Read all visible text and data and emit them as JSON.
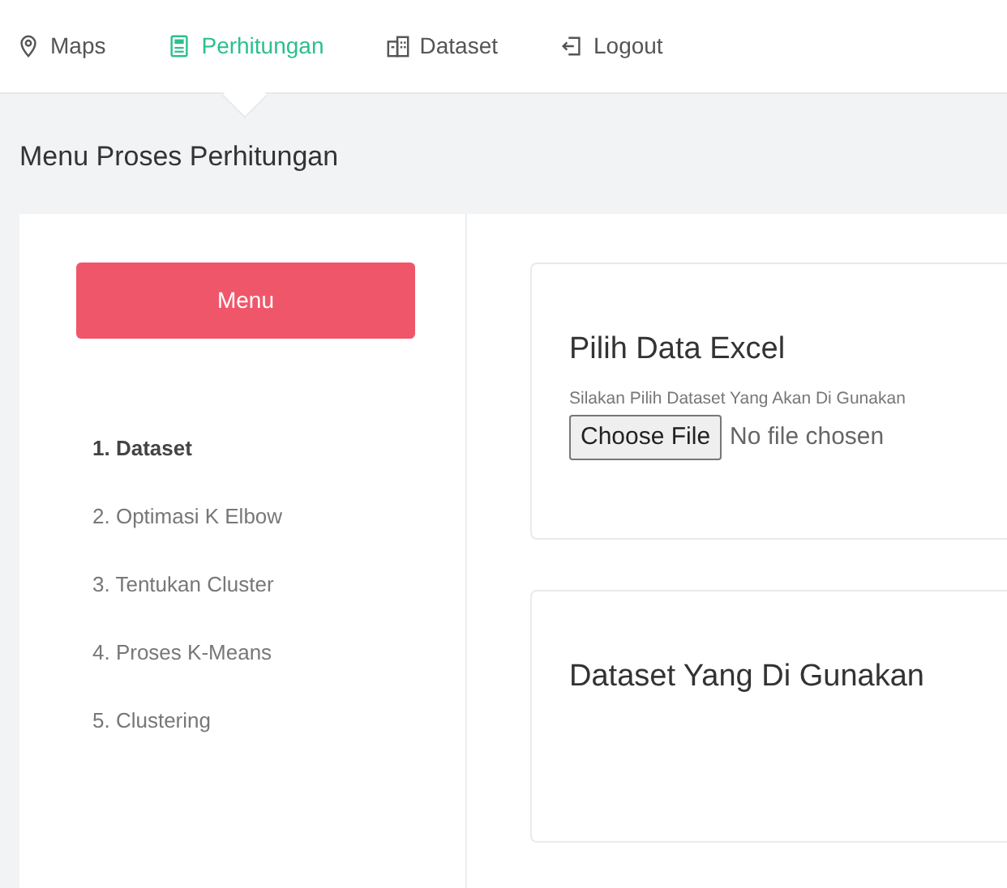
{
  "nav": [
    {
      "label": "Maps",
      "selected": false
    },
    {
      "label": "Perhitungan",
      "selected": true
    },
    {
      "label": "Dataset",
      "selected": false
    },
    {
      "label": "Logout",
      "selected": false
    }
  ],
  "page_title": "Menu Proses Perhitungan",
  "sidebar": {
    "button": "Menu",
    "items": [
      {
        "label": "1. Dataset",
        "selected": true
      },
      {
        "label": "2. Optimasi K Elbow",
        "selected": false
      },
      {
        "label": "3. Tentukan Cluster",
        "selected": false
      },
      {
        "label": "4. Proses K-Means",
        "selected": false
      },
      {
        "label": "5. Clustering",
        "selected": false
      }
    ]
  },
  "upload_card": {
    "title": "Pilih Data Excel",
    "hint": "Silakan Pilih Dataset Yang Akan Di Gunakan",
    "file_button": "Choose File",
    "file_status": "No file chosen"
  },
  "dataset_card": {
    "title": "Dataset Yang Di Gunakan"
  }
}
